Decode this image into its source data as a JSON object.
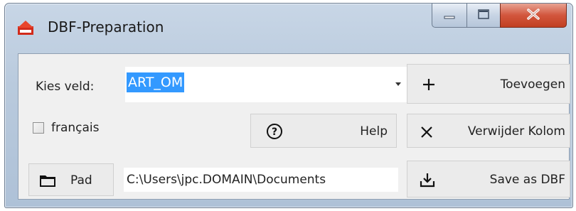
{
  "window": {
    "title": "DBF-Preparation"
  },
  "field_select": {
    "label": "Kies veld:",
    "selected_value": "ART_OM"
  },
  "buttons": {
    "add": "Toevoegen",
    "help": "Help",
    "remove_column": "Verwijder Kolom",
    "path": "Pad",
    "save": "Save as DBF"
  },
  "checkbox": {
    "label": "français",
    "checked": false
  },
  "path": {
    "value": "C:\\Users\\jpc.DOMAIN\\Documents"
  },
  "colors": {
    "selection": "#3399ff",
    "close_button": "#c13f22",
    "panel_bg": "#f0f0f0"
  },
  "icons": {
    "app": "app-icon",
    "add": "plus-icon",
    "help": "question-circle-icon",
    "remove": "x-icon",
    "path": "folder-icon",
    "save": "download-icon"
  }
}
